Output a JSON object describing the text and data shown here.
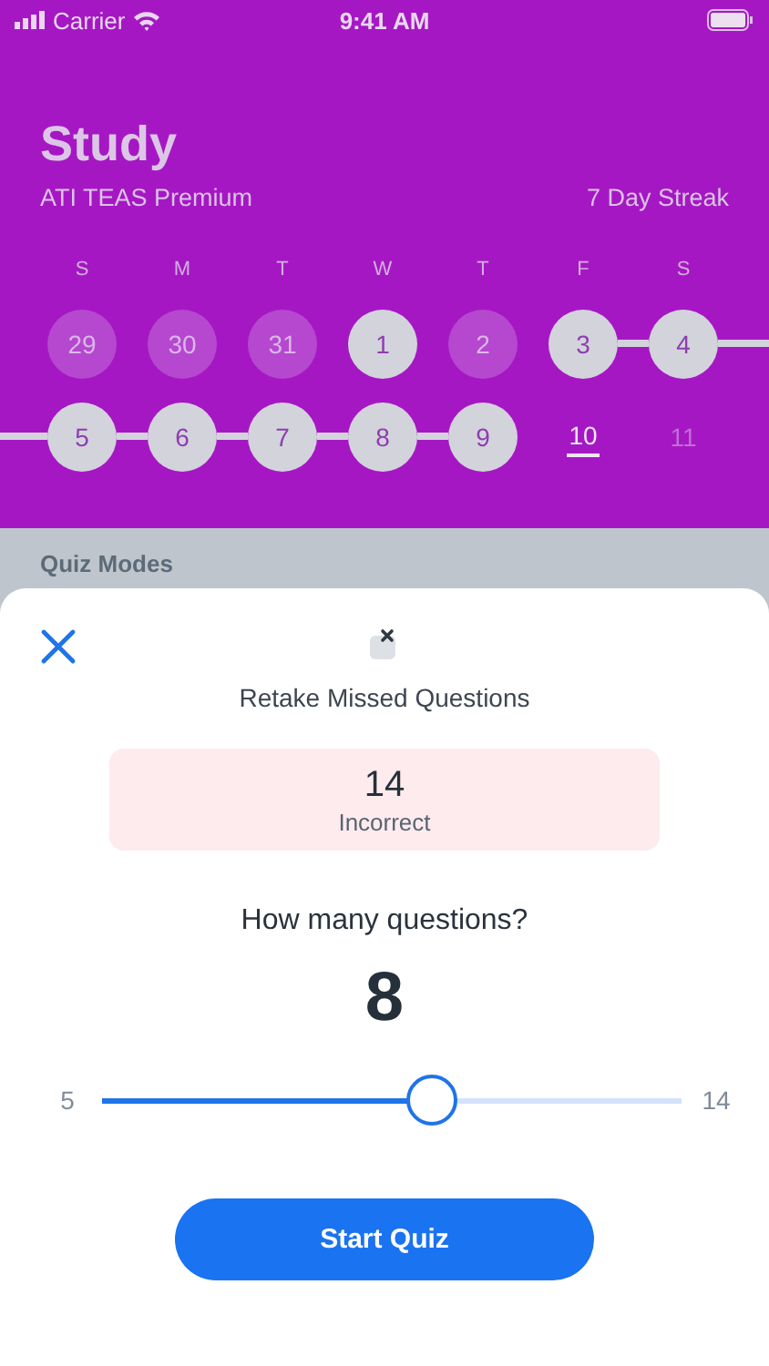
{
  "status_bar": {
    "carrier": "Carrier",
    "time": "9:41 AM"
  },
  "header": {
    "title": "Study",
    "subtitle": "ATI TEAS Premium",
    "streak": "7 Day Streak"
  },
  "calendar": {
    "weekdays": [
      "S",
      "M",
      "T",
      "W",
      "T",
      "F",
      "S"
    ],
    "weeks": [
      [
        {
          "day": "29",
          "kind": "missed"
        },
        {
          "day": "30",
          "kind": "missed"
        },
        {
          "day": "31",
          "kind": "missed"
        },
        {
          "day": "1",
          "kind": "studied"
        },
        {
          "day": "2",
          "kind": "missed"
        },
        {
          "day": "3",
          "kind": "studied"
        },
        {
          "day": "4",
          "kind": "studied"
        }
      ],
      [
        {
          "day": "5",
          "kind": "studied"
        },
        {
          "day": "6",
          "kind": "studied"
        },
        {
          "day": "7",
          "kind": "studied"
        },
        {
          "day": "8",
          "kind": "studied"
        },
        {
          "day": "9",
          "kind": "studied"
        },
        {
          "day": "10",
          "kind": "today"
        },
        {
          "day": "11",
          "kind": "future"
        }
      ]
    ]
  },
  "section_title": "Quiz Modes",
  "sheet": {
    "title": "Retake Missed Questions",
    "count": "14",
    "count_label": "Incorrect",
    "question": "How many questions?",
    "value": "8",
    "slider": {
      "min": "5",
      "max": "14",
      "level": 0.57
    },
    "button": "Start Quiz"
  }
}
